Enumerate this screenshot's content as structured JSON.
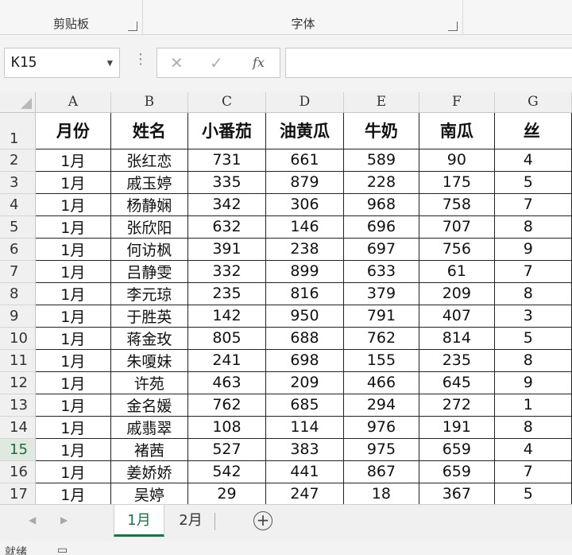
{
  "ribbon": {
    "clipboard_group": "剪贴板",
    "font_group": "字体"
  },
  "formula_bar": {
    "name_box": "K15",
    "formula": ""
  },
  "columns": [
    "A",
    "B",
    "C",
    "D",
    "E",
    "F",
    "G"
  ],
  "header_row": [
    "月份",
    "姓名",
    "小番茄",
    "油黄瓜",
    "牛奶",
    "南瓜",
    "丝"
  ],
  "rows": [
    {
      "num": "2",
      "cells": [
        "1月",
        "张红恋",
        "731",
        "661",
        "589",
        "90",
        "4"
      ]
    },
    {
      "num": "3",
      "cells": [
        "1月",
        "戚玉婷",
        "335",
        "879",
        "228",
        "175",
        "5"
      ]
    },
    {
      "num": "4",
      "cells": [
        "1月",
        "杨静娴",
        "342",
        "306",
        "968",
        "758",
        "7"
      ]
    },
    {
      "num": "5",
      "cells": [
        "1月",
        "张欣阳",
        "632",
        "146",
        "696",
        "707",
        "8"
      ]
    },
    {
      "num": "6",
      "cells": [
        "1月",
        "何访枫",
        "391",
        "238",
        "697",
        "756",
        "9"
      ]
    },
    {
      "num": "7",
      "cells": [
        "1月",
        "吕静雯",
        "332",
        "899",
        "633",
        "61",
        "7"
      ]
    },
    {
      "num": "8",
      "cells": [
        "1月",
        "李元琼",
        "235",
        "816",
        "379",
        "209",
        "8"
      ]
    },
    {
      "num": "9",
      "cells": [
        "1月",
        "于胜英",
        "142",
        "950",
        "791",
        "407",
        "3"
      ]
    },
    {
      "num": "10",
      "cells": [
        "1月",
        "蒋金玫",
        "805",
        "688",
        "762",
        "814",
        "5"
      ]
    },
    {
      "num": "11",
      "cells": [
        "1月",
        "朱嗄妹",
        "241",
        "698",
        "155",
        "235",
        "8"
      ]
    },
    {
      "num": "12",
      "cells": [
        "1月",
        "许苑",
        "463",
        "209",
        "466",
        "645",
        "9"
      ]
    },
    {
      "num": "13",
      "cells": [
        "1月",
        "金名媛",
        "762",
        "685",
        "294",
        "272",
        "1"
      ]
    },
    {
      "num": "14",
      "cells": [
        "1月",
        "戚翡翠",
        "108",
        "114",
        "976",
        "191",
        "8"
      ]
    },
    {
      "num": "15",
      "cells": [
        "1月",
        "褚茜",
        "527",
        "383",
        "975",
        "659",
        "4"
      ]
    },
    {
      "num": "16",
      "cells": [
        "1月",
        "姜娇娇",
        "542",
        "441",
        "867",
        "659",
        "7"
      ]
    },
    {
      "num": "17",
      "cells": [
        "1月",
        "吴婷",
        "29",
        "247",
        "18",
        "367",
        "5"
      ]
    }
  ],
  "header_row_num": "1",
  "selected_row": "15",
  "sheet_tabs": [
    "1月",
    "2月"
  ],
  "status": {
    "ready": "就绪"
  },
  "colors": {
    "accent": "#1e7145"
  }
}
